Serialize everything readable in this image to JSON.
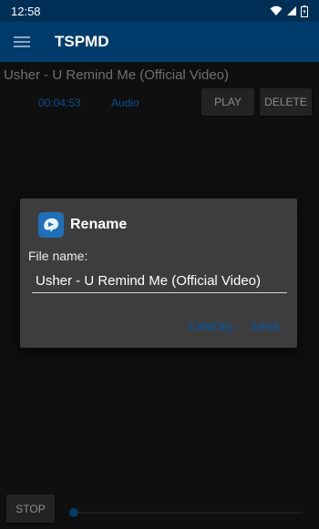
{
  "status_bar": {
    "time": "12:58"
  },
  "app_bar": {
    "title": "TSPMD"
  },
  "track": {
    "title": "Usher - U Remind Me (Official Video)",
    "duration": "00:04:53",
    "type": "Audio",
    "play_label": "PLAY",
    "delete_label": "DELETE"
  },
  "player": {
    "stop_label": "STOP",
    "progress": 0.0
  },
  "dialog": {
    "title": "Rename",
    "field_label": "File name:",
    "file_name": "Usher - U Remind Me (Official Video)",
    "cancel_label": "CANCEL",
    "save_label": "SAVE"
  },
  "colors": {
    "app_bar": "#003c6b",
    "accent": "#0a5294",
    "dialog_bg": "#3d3d3d"
  },
  "icons": [
    "menu-icon",
    "wifi-icon",
    "signal-icon",
    "battery-icon",
    "app-logo-icon"
  ]
}
